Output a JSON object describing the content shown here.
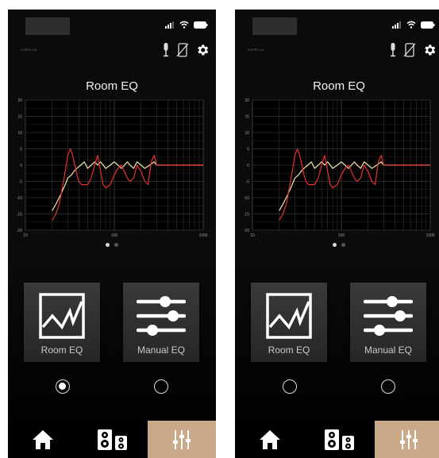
{
  "screens": [
    {
      "brand": "CAPELLA",
      "title": "Room EQ",
      "selected_mode": "room_eq",
      "mode_buttons": [
        {
          "label": "Room EQ",
          "icon": "room-eq-graph-icon"
        },
        {
          "label": "Manual EQ",
          "icon": "sliders-icon"
        }
      ],
      "tabs": [
        {
          "icon": "home-icon",
          "active": false
        },
        {
          "icon": "speakers-icon",
          "active": false
        },
        {
          "icon": "equalizer-icon",
          "active": true
        }
      ]
    },
    {
      "brand": "CAPELLA",
      "title": "Room EQ",
      "selected_mode": "none",
      "mode_buttons": [
        {
          "label": "Room EQ",
          "icon": "room-eq-graph-icon"
        },
        {
          "label": "Manual EQ",
          "icon": "sliders-icon"
        }
      ],
      "tabs": [
        {
          "icon": "home-icon",
          "active": false
        },
        {
          "icon": "speakers-icon",
          "active": false
        },
        {
          "icon": "equalizer-icon",
          "active": true
        }
      ]
    }
  ],
  "colors": {
    "measured_curve": "#e8312f",
    "target_curve": "#f2e6b0",
    "active_tab": "#c9a98a"
  },
  "chart_data": {
    "type": "line",
    "xscale": "log",
    "xlim": [
      10,
      1000
    ],
    "ylim": [
      -20,
      20
    ],
    "x_ticks": [
      "10",
      "100",
      "1000"
    ],
    "y_ticks": [
      "20",
      "15",
      "10",
      "5",
      "0",
      "-5",
      "-10",
      "-15",
      "-20"
    ],
    "grid": true,
    "series": [
      {
        "color": "#f2e6b0",
        "x": [
          20,
          22,
          25,
          28,
          30,
          33,
          35,
          38,
          42,
          46,
          50,
          55,
          60,
          65,
          70,
          75,
          80,
          90,
          100,
          110,
          120,
          130,
          140,
          150,
          165,
          180,
          200,
          220,
          250,
          280,
          300,
          400,
          600,
          1000
        ],
        "y": [
          -14,
          -12,
          -9,
          -6,
          -4,
          -3,
          -2,
          -1,
          0,
          1,
          -1,
          0,
          1,
          0,
          1,
          0,
          -1,
          0,
          1,
          0,
          -1,
          0,
          1,
          0,
          -1,
          1,
          0,
          -1,
          0,
          1,
          0,
          0,
          0,
          0
        ]
      },
      {
        "color": "#e8312f",
        "x": [
          20,
          22,
          24,
          26,
          28,
          30,
          32,
          34,
          36,
          38,
          40,
          43,
          46,
          50,
          55,
          60,
          65,
          70,
          75,
          80,
          90,
          100,
          110,
          120,
          130,
          140,
          150,
          165,
          180,
          200,
          220,
          240,
          260,
          280,
          300,
          400,
          600,
          1000
        ],
        "y": [
          -17,
          -15,
          -12,
          -7,
          -2,
          3,
          5,
          3,
          0,
          -3,
          -5,
          -6,
          -6,
          -6,
          -4,
          0,
          3,
          -2,
          -6,
          -7,
          -6,
          -3,
          -1,
          0,
          -2,
          -4,
          -5,
          -4,
          0,
          -2,
          -5,
          -6,
          1,
          3,
          0,
          0,
          0,
          0
        ]
      }
    ]
  }
}
